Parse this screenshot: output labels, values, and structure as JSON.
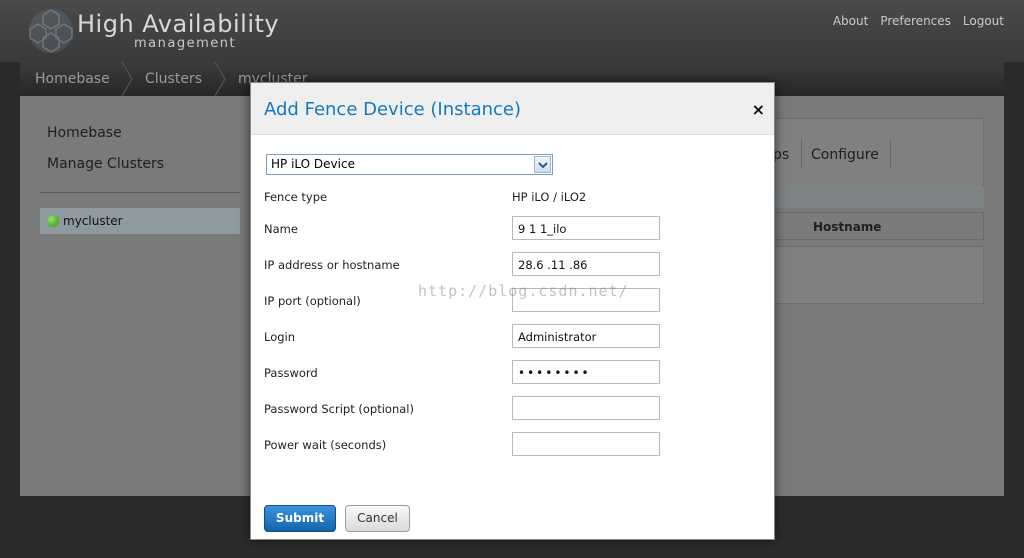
{
  "app": {
    "brand_title": "High Availability",
    "brand_subtitle": "management"
  },
  "top_links": [
    "About",
    "Preferences",
    "Logout"
  ],
  "breadcrumb": [
    "Homebase",
    "Clusters",
    "mycluster"
  ],
  "sidebar": {
    "homebase_label": "Homebase",
    "manage_clusters_label": "Manage Clusters",
    "cluster_name": "mycluster"
  },
  "background_panel": {
    "tab_partial": "ps",
    "tab_configure": "Configure",
    "column_hostname": "Hostname"
  },
  "modal": {
    "title": "Add Fence Device (Instance)",
    "close_symbol": "×",
    "device_select_value": "HP iLO Device",
    "fields": {
      "fence_type_label": "Fence type",
      "fence_type_value": "HP iLO / iLO2",
      "name_label": "Name",
      "name_value": "9  1  1_ilo",
      "ip_label": "IP address or hostname",
      "ip_value": " 28.6  .11  .86",
      "ip_port_label": "IP port (optional)",
      "ip_port_value": "",
      "login_label": "Login",
      "login_value": "Administrator",
      "password_label": "Password",
      "password_value": "••••••••",
      "password_script_label": "Password Script (optional)",
      "password_script_value": "",
      "power_wait_label": "Power wait (seconds)",
      "power_wait_value": ""
    },
    "watermark": "http://blog.csdn.net/",
    "submit_label": "Submit",
    "cancel_label": "Cancel"
  },
  "colors": {
    "title_blue": "#1579c2",
    "submit_blue": "#1a6fb8",
    "status_green": "#3fae1c"
  },
  "icons": [
    "logo-hexagon-icon",
    "chevron-right-icon",
    "status-dot-icon",
    "dropdown-arrow-icon",
    "close-icon"
  ]
}
